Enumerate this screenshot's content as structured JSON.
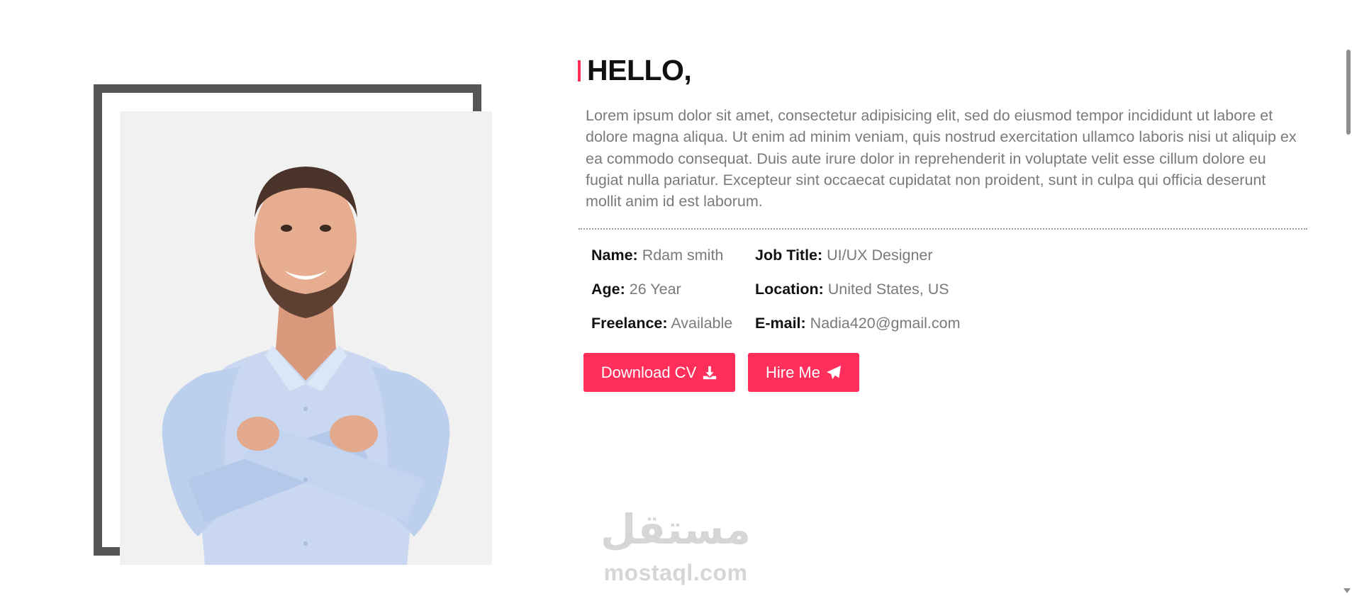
{
  "about": {
    "heading": "HELLO,",
    "bio": "Lorem ipsum dolor sit amet, consectetur adipisicing elit, sed do eiusmod tempor incididunt ut labore et dolore magna aliqua. Ut enim ad minim veniam, quis nostrud exercitation ullamco laboris nisi ut aliquip ex ea commodo consequat. Duis aute irure dolor in reprehenderit in voluptate velit esse cillum dolore eu fugiat nulla pariatur. Excepteur sint occaecat cupidatat non proident, sunt in culpa qui officia deserunt mollit anim id est laborum."
  },
  "info": {
    "name": {
      "label": "Name:",
      "value": "Rdam smith"
    },
    "age": {
      "label": "Age:",
      "value": "26 Year"
    },
    "freelance": {
      "label": "Freelance:",
      "value": "Available"
    },
    "job_title": {
      "label": "Job Title:",
      "value": "UI/UX Designer"
    },
    "location": {
      "label": "Location:",
      "value": "United States, US"
    },
    "email": {
      "label": "E-mail:",
      "value": "Nadia420@gmail.com"
    }
  },
  "buttons": {
    "download_cv": {
      "label": "Download CV",
      "icon": "download-icon"
    },
    "hire_me": {
      "label": "Hire Me",
      "icon": "paper-plane-icon"
    }
  },
  "watermark": {
    "arabic": "مستقل",
    "latin": "mostaql.com"
  },
  "colors": {
    "accent": "#ff2e5b",
    "frame": "#555555",
    "text_muted": "#7a7a7a"
  }
}
